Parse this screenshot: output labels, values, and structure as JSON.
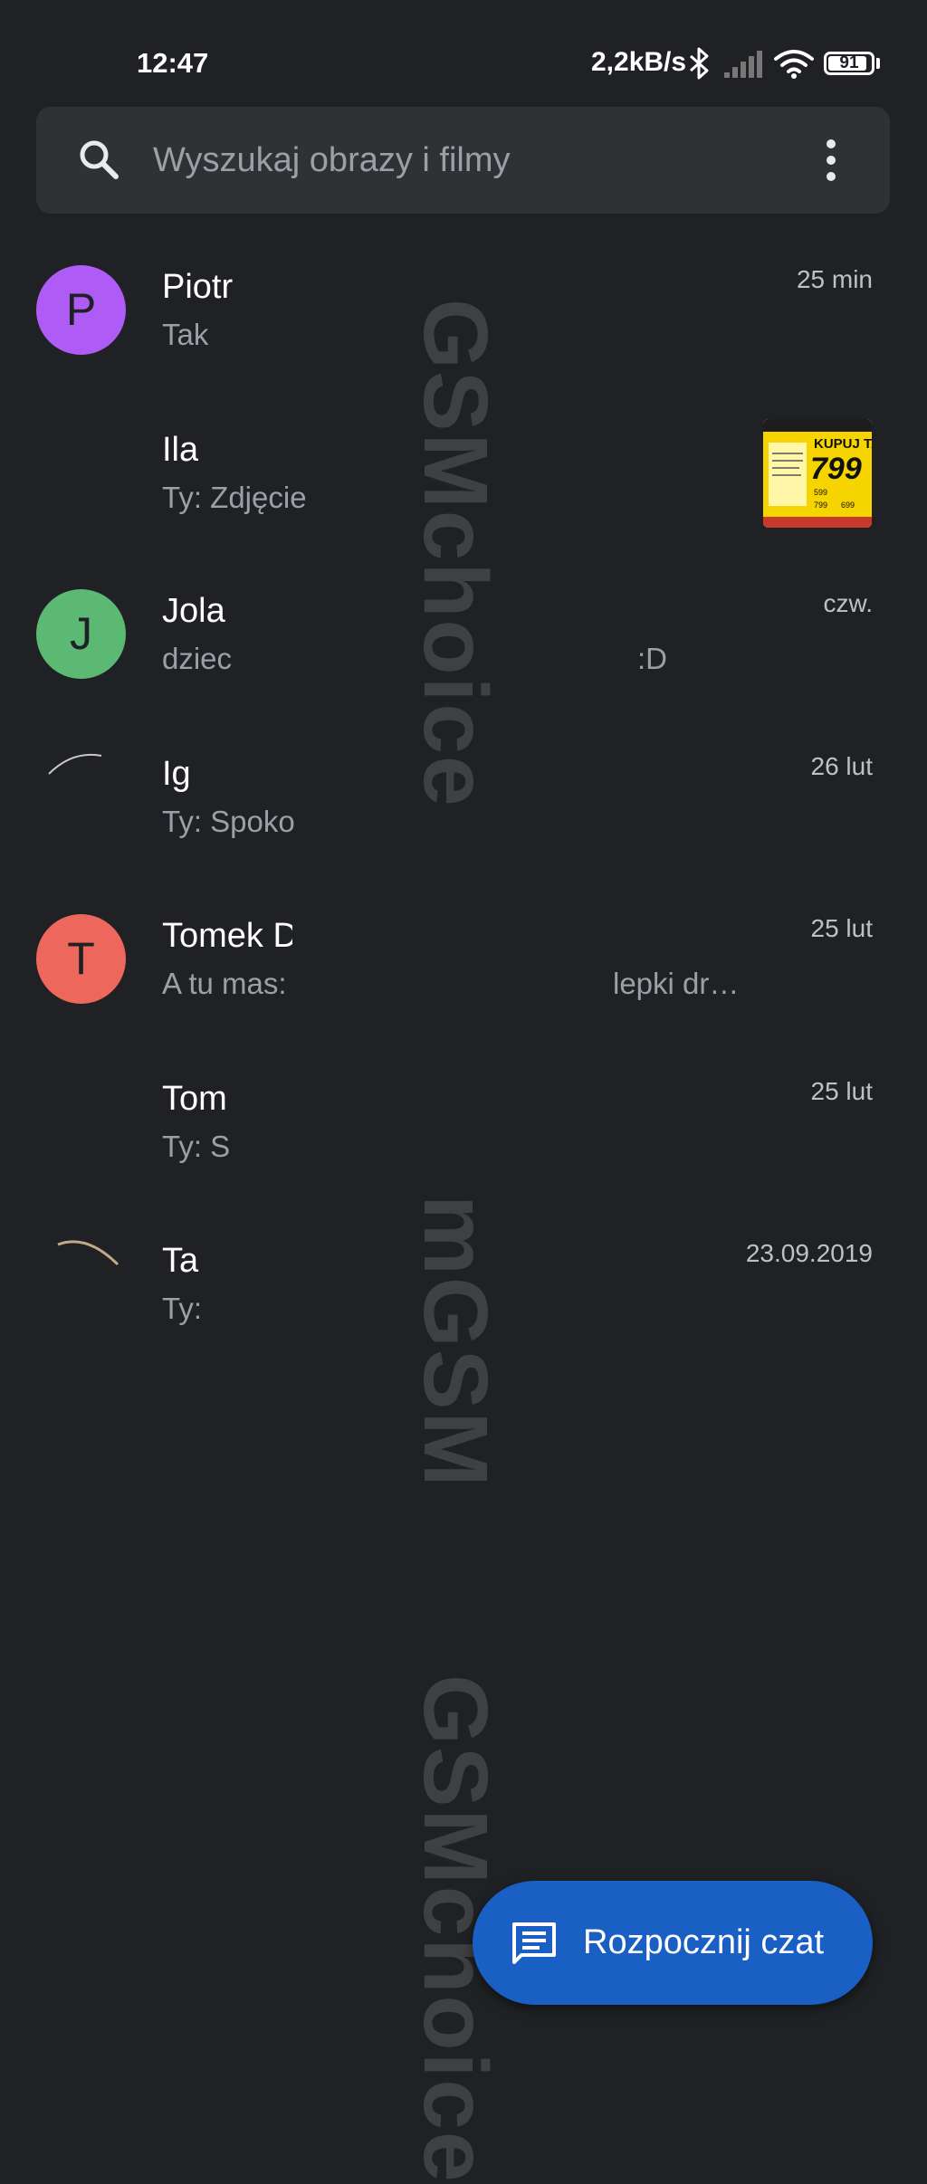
{
  "status_bar": {
    "time": "12:47",
    "net_speed": "2,2kB/s",
    "battery": "91",
    "battery_level": 0.91,
    "icons": [
      "bluetooth-icon",
      "signal-icon",
      "wifi-icon",
      "battery-icon"
    ]
  },
  "search": {
    "placeholder": "Wyszukaj obrazy i filmy",
    "icons": [
      "search-icon",
      "more-vert-icon"
    ]
  },
  "conversations": [
    {
      "name": "Piotr",
      "message": "Tak",
      "message_tail": "",
      "time": "25 min",
      "avatar_letter": "P",
      "avatar_color": "#af5cf7"
    },
    {
      "name": "Ila",
      "message": "Ty: Zdjęcie",
      "message_tail": "",
      "time": "",
      "avatar_letter": "",
      "avatar_color": ""
    },
    {
      "name": "Jola",
      "message": "dziec",
      "message_tail": ":D",
      "time": "czw.",
      "avatar_letter": "J",
      "avatar_color": "#5bb974"
    },
    {
      "name": "Ig",
      "message": "Ty: Spoko",
      "message_tail": "",
      "time": "26 lut",
      "avatar_letter": "",
      "avatar_color": ""
    },
    {
      "name": "Tomek D",
      "message": "A tu mas:",
      "message_tail": "lepki dr…",
      "time": "25 lut",
      "avatar_letter": "T",
      "avatar_color": "#ee675c"
    },
    {
      "name": "Tom",
      "message": "Ty: S",
      "message_tail": "",
      "time": "25 lut",
      "avatar_letter": "",
      "avatar_color": ""
    },
    {
      "name": "Ta",
      "message": "Ty:",
      "message_tail": "",
      "time": "23.09.2019",
      "avatar_letter": "",
      "avatar_color": ""
    }
  ],
  "thumbnail": {
    "header": "KUPUJ TAN",
    "price": "799",
    "small_price_1": "599",
    "small_price_2": "799",
    "small_price_3": "699"
  },
  "watermark": {
    "text_1": "GSMchoice",
    "text_2": "mGSM",
    "text_3": "GSMchoice"
  },
  "fab": {
    "label": "Rozpocznij czat",
    "icon": "chat-icon",
    "color": "#1a5fc4"
  }
}
